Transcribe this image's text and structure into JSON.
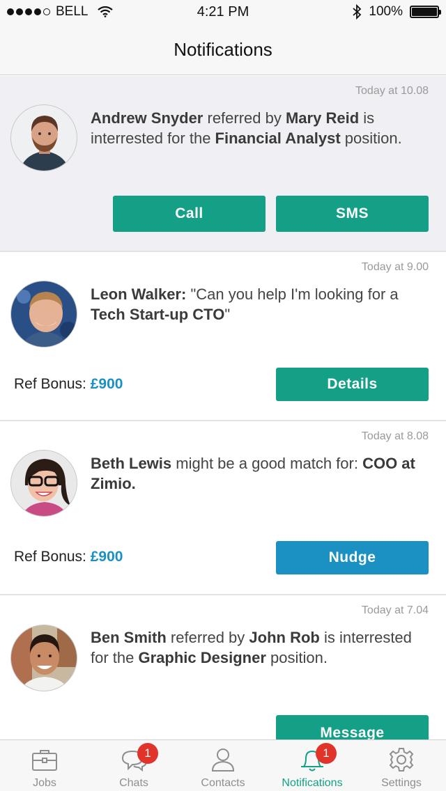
{
  "status_bar": {
    "carrier": "BELL",
    "time": "4:21 PM",
    "battery": "100%",
    "battery_level": 1.0,
    "signal_icon": "signal-dots-icon",
    "wifi_icon": "wifi-icon",
    "bluetooth_icon": "bluetooth-icon"
  },
  "nav": {
    "title": "Notifications"
  },
  "notifications": [
    {
      "time": "Today at 10.08",
      "name": "Andrew Snyder",
      "t1": " referred by ",
      "referrer": "Mary Reid",
      "t2": " is interrested for the ",
      "position": "Financial Analyst",
      "t3": " position.",
      "buttons": [
        "Call",
        "SMS"
      ]
    },
    {
      "time": "Today at 9.00",
      "name": "Leon Walker:",
      "t1": " \"Can you help I'm looking for a ",
      "role": "Tech Start-up CTO",
      "t2": "\"",
      "ref_label": "Ref Bonus: ",
      "ref_amount": "£900",
      "button": "Details"
    },
    {
      "time": "Today at 8.08",
      "name": "Beth Lewis",
      "t1": " might be a good match for: ",
      "role": "COO at Zimio.",
      "ref_label": "Ref Bonus: ",
      "ref_amount": "£900",
      "button": "Nudge"
    },
    {
      "time": "Today at 7.04",
      "name": "Ben Smith",
      "t1": " referred by ",
      "referrer": "John Rob",
      "t2": " is interrested for the ",
      "position": "Graphic Designer",
      "t3": " position.",
      "button": "Message"
    }
  ],
  "tabs": [
    {
      "label": "Jobs",
      "icon": "briefcase-icon",
      "badge": ""
    },
    {
      "label": "Chats",
      "icon": "chat-bubbles-icon",
      "badge": "1"
    },
    {
      "label": "Contacts",
      "icon": "person-icon",
      "badge": ""
    },
    {
      "label": "Notifications",
      "icon": "bell-icon",
      "badge": "1",
      "active": true
    },
    {
      "label": "Settings",
      "icon": "gear-icon",
      "badge": ""
    }
  ],
  "colors": {
    "accent": "#13a087",
    "nudge": "#1a91c2",
    "badge": "#e2332b"
  }
}
